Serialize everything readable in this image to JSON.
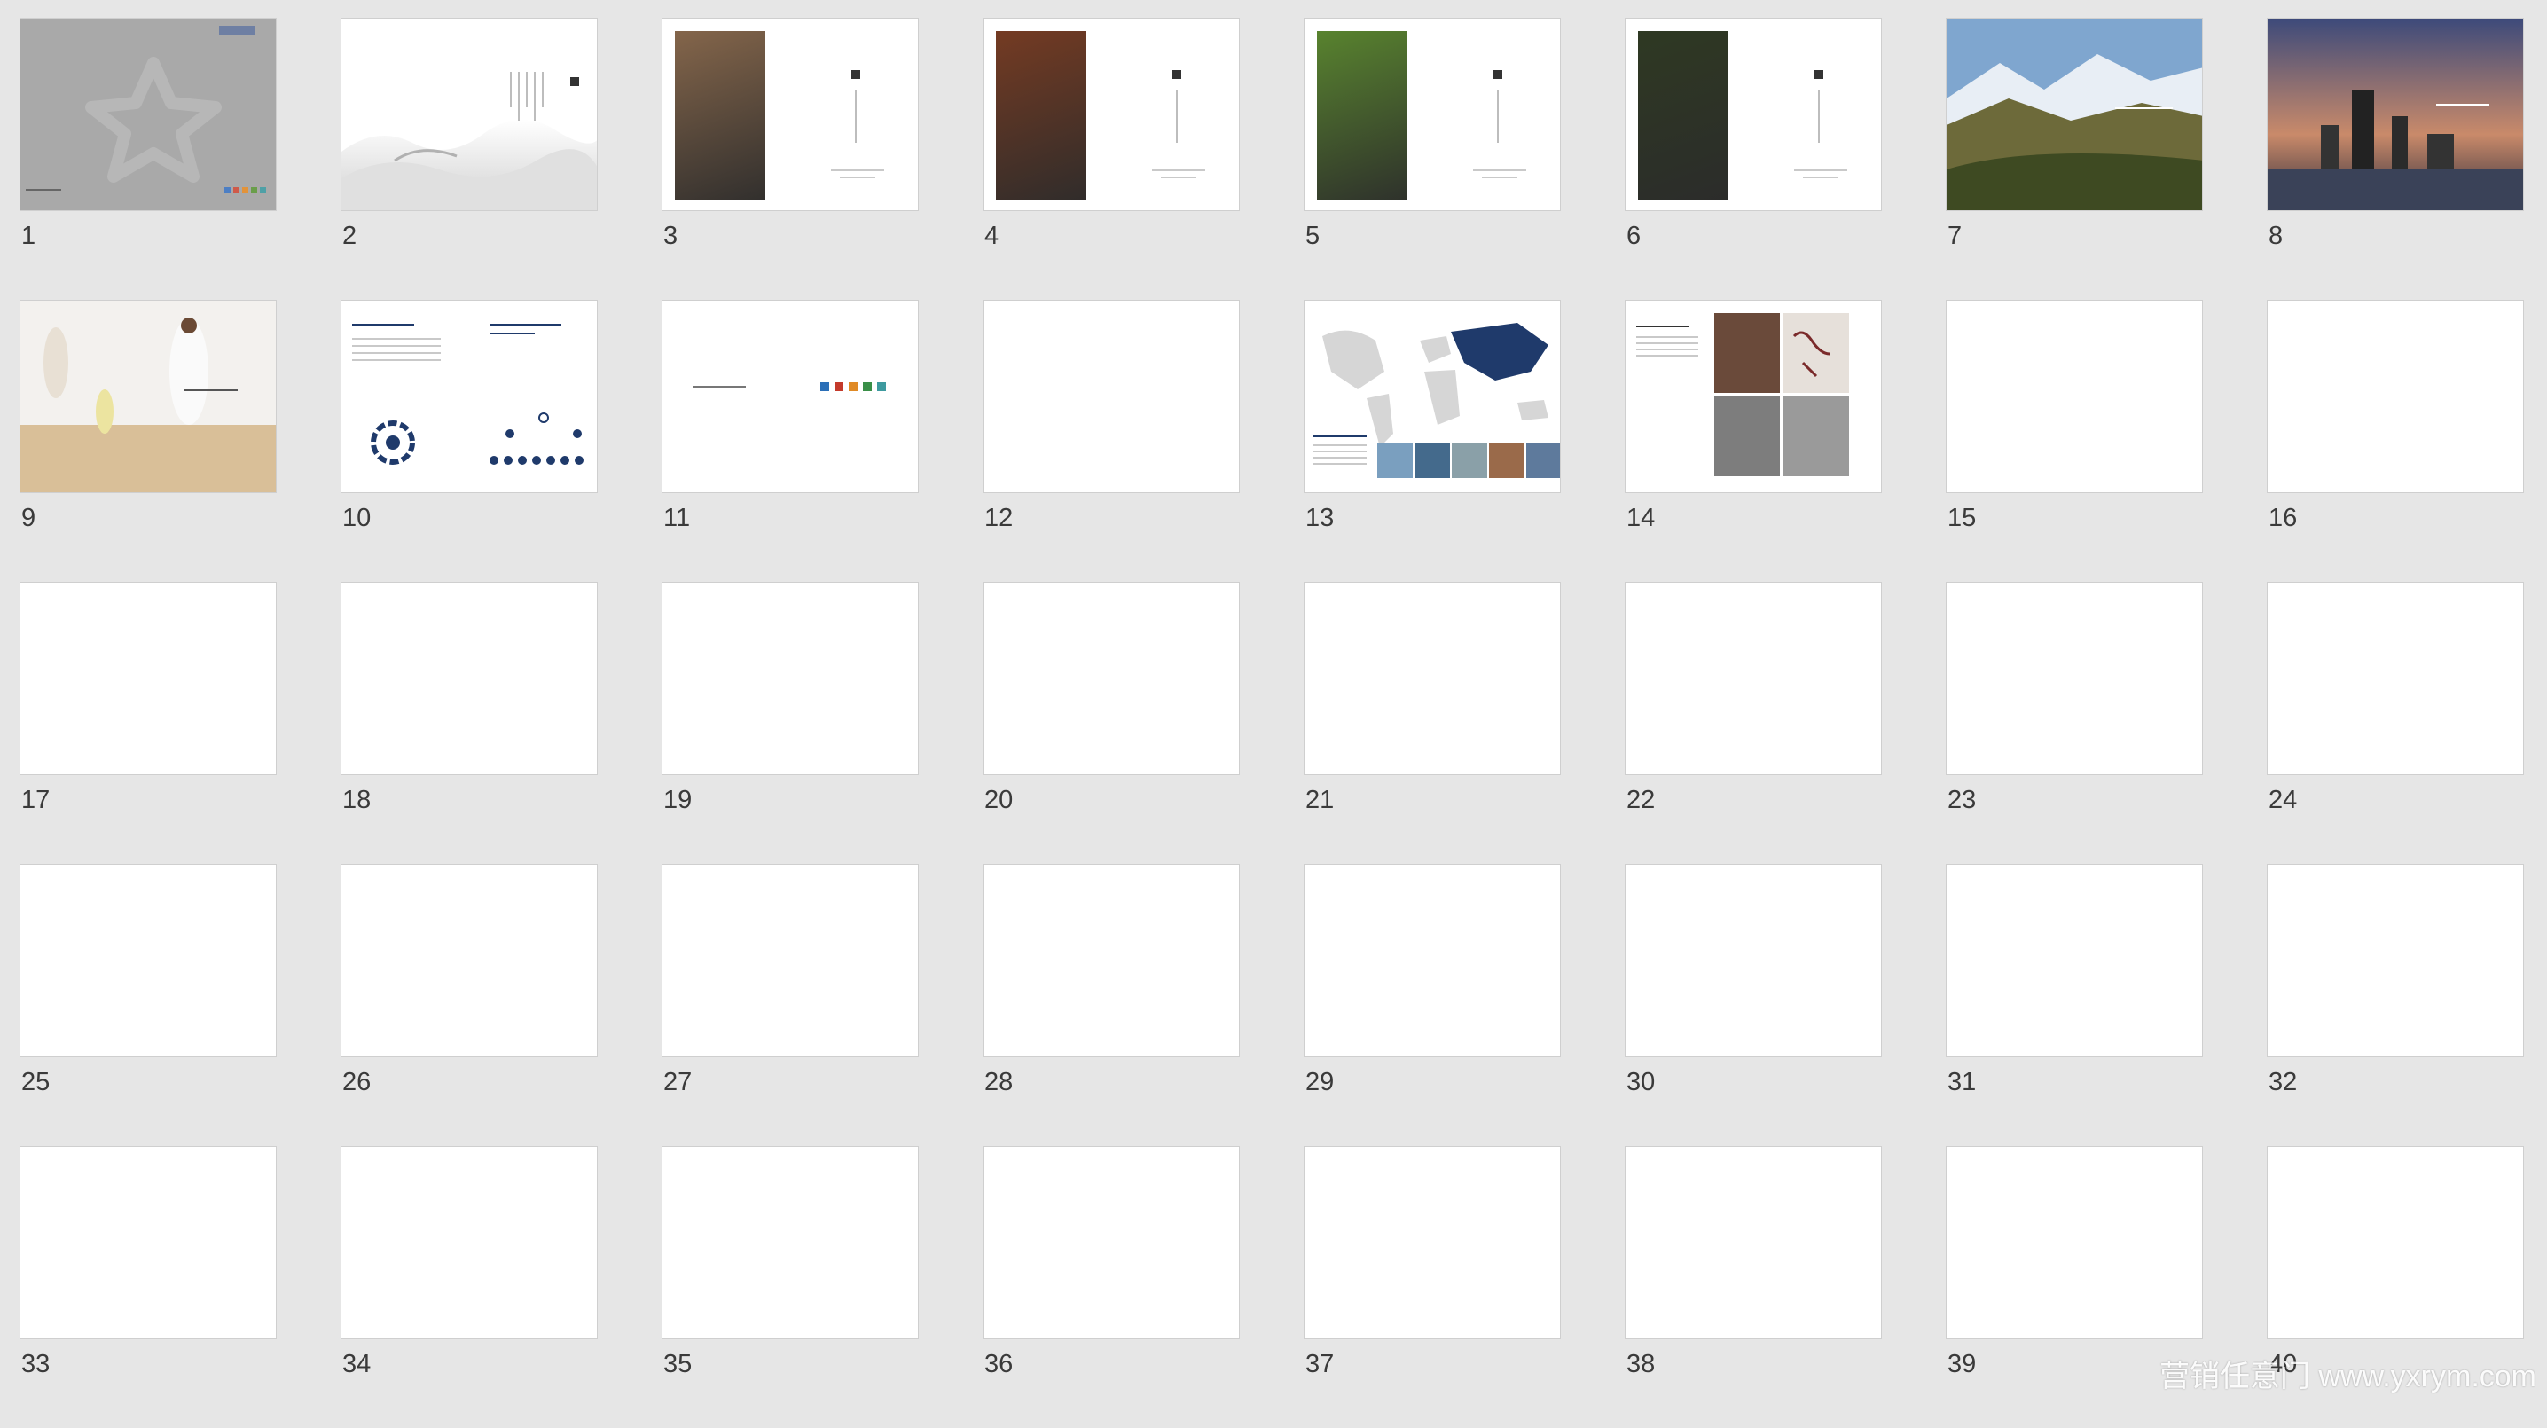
{
  "slides": [
    {
      "number": "1",
      "kind": "cover"
    },
    {
      "number": "2",
      "kind": "mist"
    },
    {
      "number": "3",
      "kind": "photo-left",
      "accent": "#8b6a4d"
    },
    {
      "number": "4",
      "kind": "photo-left",
      "accent": "#7a3c22"
    },
    {
      "number": "5",
      "kind": "photo-left",
      "accent": "#5c8a2f"
    },
    {
      "number": "6",
      "kind": "photo-left",
      "accent": "#2f3a22"
    },
    {
      "number": "7",
      "kind": "landscape"
    },
    {
      "number": "8",
      "kind": "city"
    },
    {
      "number": "9",
      "kind": "beach"
    },
    {
      "number": "10",
      "kind": "diagram"
    },
    {
      "number": "11",
      "kind": "logos"
    },
    {
      "number": "12",
      "kind": "blank"
    },
    {
      "number": "13",
      "kind": "map"
    },
    {
      "number": "14",
      "kind": "history"
    },
    {
      "number": "15",
      "kind": "blank"
    },
    {
      "number": "16",
      "kind": "blank"
    },
    {
      "number": "17",
      "kind": "blank"
    },
    {
      "number": "18",
      "kind": "blank"
    },
    {
      "number": "19",
      "kind": "blank"
    },
    {
      "number": "20",
      "kind": "blank"
    },
    {
      "number": "21",
      "kind": "blank"
    },
    {
      "number": "22",
      "kind": "blank"
    },
    {
      "number": "23",
      "kind": "blank"
    },
    {
      "number": "24",
      "kind": "blank"
    },
    {
      "number": "25",
      "kind": "blank"
    },
    {
      "number": "26",
      "kind": "blank"
    },
    {
      "number": "27",
      "kind": "blank"
    },
    {
      "number": "28",
      "kind": "blank"
    },
    {
      "number": "29",
      "kind": "blank"
    },
    {
      "number": "30",
      "kind": "blank"
    },
    {
      "number": "31",
      "kind": "blank"
    },
    {
      "number": "32",
      "kind": "blank"
    },
    {
      "number": "33",
      "kind": "blank"
    },
    {
      "number": "34",
      "kind": "blank"
    },
    {
      "number": "35",
      "kind": "blank"
    },
    {
      "number": "36",
      "kind": "blank"
    },
    {
      "number": "37",
      "kind": "blank"
    },
    {
      "number": "38",
      "kind": "blank"
    },
    {
      "number": "39",
      "kind": "blank"
    },
    {
      "number": "40",
      "kind": "blank"
    }
  ],
  "watermark": "营销任意门  www.yxrym.com",
  "colors": {
    "background": "#e6e6e6",
    "navy": "#1f3a6b",
    "cover_gray": "#a9a9a9"
  }
}
